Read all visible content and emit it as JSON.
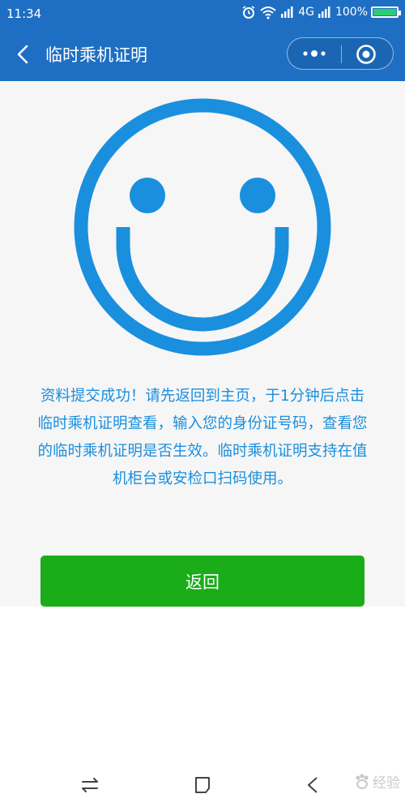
{
  "status_bar": {
    "time": "11:34",
    "network": "4G",
    "battery_text": "100%",
    "battery_level": 1.0,
    "icons": [
      "alarm-icon",
      "wifi-icon",
      "signal-icon",
      "signal-icon",
      "battery-icon"
    ]
  },
  "header": {
    "title": "临时乘机证明",
    "back_icon": "chevron-left-icon",
    "more_icon": "more-dots-icon",
    "close_icon": "close-circle-icon"
  },
  "main": {
    "illustration": "smiley-face-icon",
    "message": "资料提交成功！请先返回到主页，于1分钟后点击临时乘机证明查看，输入您的身份证号码，查看您的临时乘机证明是否生效。临时乘机证明支持在值机柜台或安检口扫码使用。",
    "back_button_label": "返回"
  },
  "bottom_nav": {
    "icons": [
      "switch-icon",
      "home-square-icon",
      "back-triangle-icon"
    ],
    "watermark_text": "经验"
  },
  "colors": {
    "header_bg": "#1e6fc3",
    "accent": "#1a8fde",
    "button_green": "#1aad19",
    "page_bg": "#f6f6f6"
  }
}
